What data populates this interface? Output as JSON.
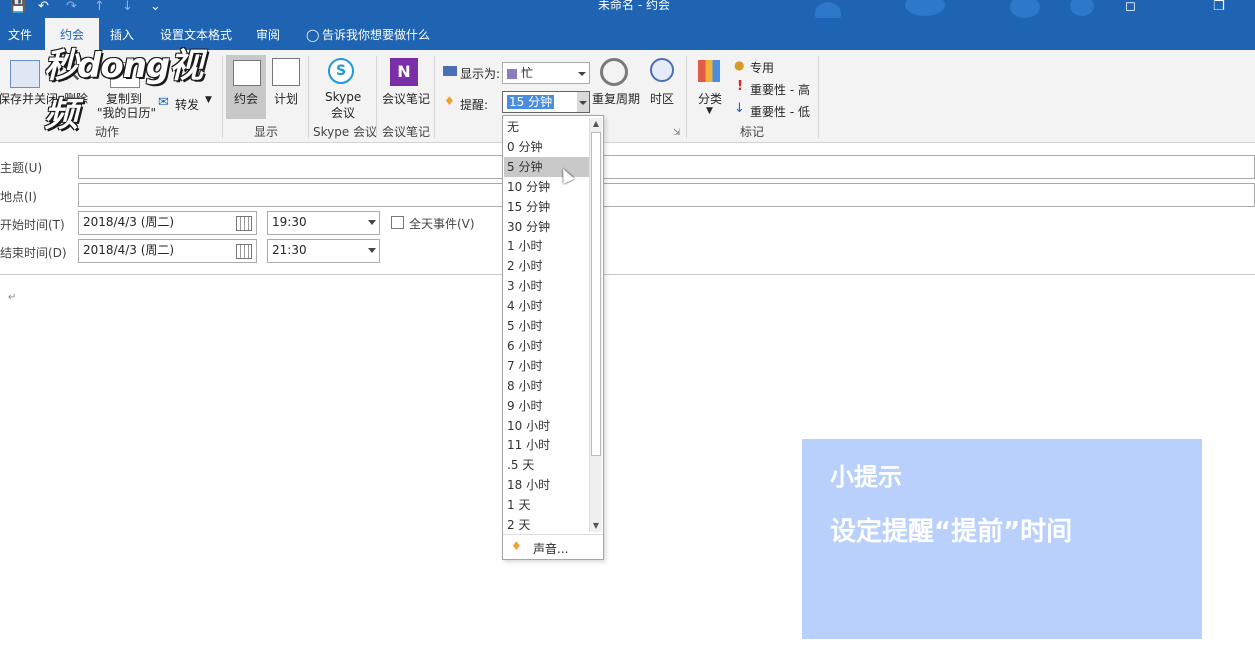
{
  "window": {
    "title": "未命名 - 约会"
  },
  "tabs": [
    {
      "label": "文件"
    },
    {
      "label": "约会"
    },
    {
      "label": "插入"
    },
    {
      "label": "设置文本格式"
    },
    {
      "label": "审阅"
    }
  ],
  "tell_me": {
    "label": "告诉我你想要做什么"
  },
  "watermark": {
    "text": "秒dong视频"
  },
  "ribbon": {
    "actions": {
      "save_close": "保存并关闭",
      "delete": "删除",
      "copy_line1": "复制到",
      "copy_line2": "\"我的日历\"",
      "forward": "转发",
      "group_label": "动作"
    },
    "show": {
      "appointment": "约会",
      "schedule": "计划",
      "group_label": "显示"
    },
    "skype": {
      "line1": "Skype",
      "line2": "会议",
      "group_label": "Skype 会议"
    },
    "notes": {
      "label": "会议笔记",
      "group_label": "会议笔记"
    },
    "options": {
      "show_as_label": "显示为:",
      "show_as_value": "忙",
      "reminder_label": "提醒:",
      "reminder_value": "15 分钟",
      "recurrence": "重复周期",
      "timezone": "时区"
    },
    "tags": {
      "categorize": "分类",
      "private": "专用",
      "high": "重要性 - 高",
      "low": "重要性 - 低",
      "group_label": "标记"
    }
  },
  "form": {
    "subject_label": "主题(U)",
    "location_label": "地点(I)",
    "start_label": "开始时间(T)",
    "end_label": "结束时间(D)",
    "start_date": "2018/4/3 (周二)",
    "start_time": "19:30",
    "end_date": "2018/4/3 (周二)",
    "end_time": "21:30",
    "all_day_label": "全天事件(V)",
    "body_mark": "↵"
  },
  "reminder_options": [
    "无",
    "0 分钟",
    "5 分钟",
    "10 分钟",
    "15 分钟",
    "30 分钟",
    "1 小时",
    "2 小时",
    "3 小时",
    "4 小时",
    "5 小时",
    "6 小时",
    "7 小时",
    "8 小时",
    "9 小时",
    "10 小时",
    "11 小时",
    ".5 天",
    "18 小时",
    "1 天",
    "2 天"
  ],
  "reminder_highlighted": "5 分钟",
  "sound_label": "声音...",
  "tip": {
    "title": "小提示",
    "body": "设定提醒“提前”时间"
  },
  "colors": {
    "accent": "#1f63b3",
    "ribbon_bg": "#f3f3f3",
    "tip_bg": "#b8d0fb",
    "busy": "#8e7cc3"
  }
}
